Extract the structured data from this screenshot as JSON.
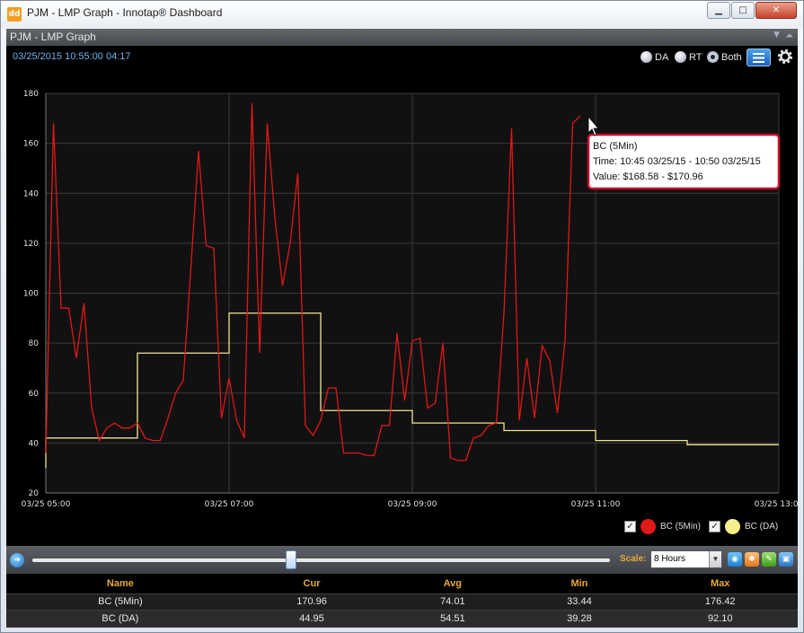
{
  "window": {
    "title": "PJM - LMP Graph - Innotap® Dashboard",
    "app_icon": "dd",
    "controls": {
      "minimize": "▁",
      "maximize": "□",
      "close": "✕"
    }
  },
  "panel": {
    "title": "PJM - LMP Graph",
    "timestamp": "03/25/2015 10:55:00  04:17",
    "radios": [
      {
        "label": "DA",
        "selected": false
      },
      {
        "label": "RT",
        "selected": false
      },
      {
        "label": "Both",
        "selected": true
      }
    ]
  },
  "chart_data": {
    "type": "line",
    "title": "",
    "xlabel": "",
    "ylabel": "",
    "ylim": [
      20,
      180
    ],
    "yticks": [
      20,
      40,
      60,
      80,
      100,
      120,
      140,
      160,
      180
    ],
    "xlim": [
      "2015-03-25 05:00",
      "2015-03-25 13:00"
    ],
    "xticks": [
      "03/25 05:00",
      "03/25 07:00",
      "03/25 09:00",
      "03/25 11:00",
      "03/25 13:00"
    ],
    "grid": true,
    "legend_placement": "bottom-right",
    "series": [
      {
        "name": "BC (5Min)",
        "color": "#e01818",
        "time_step": "5 min",
        "start": "05:00",
        "values": [
          36,
          168,
          94,
          94,
          74,
          96,
          54,
          41,
          46,
          48,
          46,
          46,
          48,
          42,
          41,
          41,
          50,
          60,
          65,
          110,
          157,
          119,
          118,
          50,
          66,
          49,
          42,
          176,
          76,
          168,
          130,
          103,
          120,
          148,
          47,
          43,
          49,
          62,
          62,
          36,
          36,
          36,
          35,
          35,
          47,
          47,
          84,
          57,
          81,
          82,
          54,
          56,
          80,
          34,
          33,
          33,
          42,
          43,
          47,
          48,
          92,
          166,
          49,
          74,
          50,
          79,
          73,
          52,
          81,
          168,
          171
        ]
      },
      {
        "name": "BC (DA)",
        "color": "#f0e68c",
        "hourly_start": "05:00",
        "hourly_values": [
          42,
          76,
          92,
          53,
          48,
          45,
          41,
          39.3
        ],
        "end": "13:00"
      }
    ],
    "tooltip": {
      "series": "BC (5Min)",
      "time": "Time: 10:45 03/25/15 - 10:50 03/25/15",
      "value": "Value: $168.58 - $170.96"
    }
  },
  "legend": [
    {
      "label": "BC (5Min)",
      "color": "#e01818",
      "checked": true
    },
    {
      "label": "BC (DA)",
      "color": "#f6f08a",
      "checked": true
    }
  ],
  "scale": {
    "label": "Scale:",
    "selected": "8 Hours"
  },
  "table": {
    "columns": [
      "Name",
      "Cur",
      "Avg",
      "Min",
      "Max"
    ],
    "rows": [
      [
        "BC (5Min)",
        "170.96",
        "74.01",
        "33.44",
        "176.42"
      ],
      [
        "BC (DA)",
        "44.95",
        "54.51",
        "39.28",
        "92.10"
      ]
    ]
  }
}
